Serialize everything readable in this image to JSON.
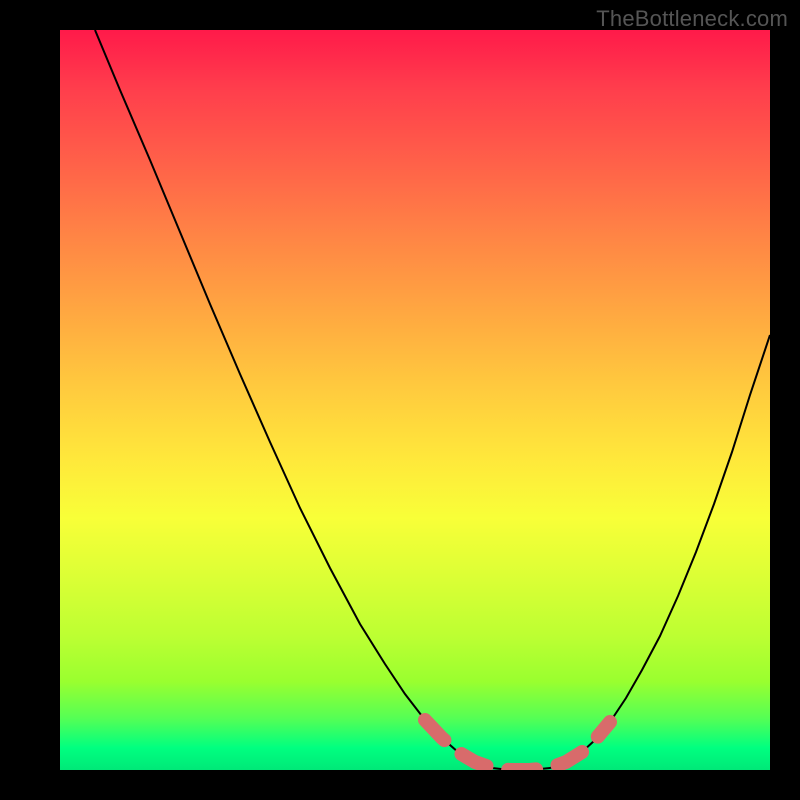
{
  "watermark": "TheBottleneck.com",
  "chart_data": {
    "type": "line",
    "title": "",
    "xlabel": "",
    "ylabel": "",
    "xlim": [
      60,
      770
    ],
    "ylim": [
      30,
      770
    ],
    "series": [
      {
        "name": "black-curve",
        "color": "#000000",
        "stroke_width": 2,
        "type": "line",
        "points": [
          {
            "x": 95,
            "y": 30
          },
          {
            "x": 120,
            "y": 90
          },
          {
            "x": 150,
            "y": 160
          },
          {
            "x": 180,
            "y": 232
          },
          {
            "x": 210,
            "y": 304
          },
          {
            "x": 240,
            "y": 374
          },
          {
            "x": 270,
            "y": 442
          },
          {
            "x": 300,
            "y": 508
          },
          {
            "x": 330,
            "y": 568
          },
          {
            "x": 360,
            "y": 624
          },
          {
            "x": 385,
            "y": 664
          },
          {
            "x": 405,
            "y": 694
          },
          {
            "x": 425,
            "y": 720
          },
          {
            "x": 442,
            "y": 738
          },
          {
            "x": 458,
            "y": 752
          },
          {
            "x": 475,
            "y": 762
          },
          {
            "x": 492,
            "y": 768
          },
          {
            "x": 510,
            "y": 770
          },
          {
            "x": 530,
            "y": 770
          },
          {
            "x": 550,
            "y": 768
          },
          {
            "x": 566,
            "y": 762
          },
          {
            "x": 582,
            "y": 752
          },
          {
            "x": 595,
            "y": 740
          },
          {
            "x": 610,
            "y": 722
          },
          {
            "x": 626,
            "y": 698
          },
          {
            "x": 642,
            "y": 670
          },
          {
            "x": 660,
            "y": 636
          },
          {
            "x": 678,
            "y": 596
          },
          {
            "x": 696,
            "y": 552
          },
          {
            "x": 714,
            "y": 504
          },
          {
            "x": 732,
            "y": 452
          },
          {
            "x": 750,
            "y": 395
          },
          {
            "x": 770,
            "y": 335
          }
        ]
      },
      {
        "name": "red-dash",
        "color": "#d86b6b",
        "stroke_width": 14,
        "type": "dashed-line",
        "dash": "28 22",
        "linecap": "round",
        "points": [
          {
            "x": 425,
            "y": 720
          },
          {
            "x": 442,
            "y": 738
          },
          {
            "x": 458,
            "y": 752
          },
          {
            "x": 475,
            "y": 762
          },
          {
            "x": 492,
            "y": 768
          },
          {
            "x": 510,
            "y": 770
          },
          {
            "x": 530,
            "y": 770
          },
          {
            "x": 550,
            "y": 768
          },
          {
            "x": 566,
            "y": 762
          },
          {
            "x": 582,
            "y": 752
          },
          {
            "x": 595,
            "y": 740
          },
          {
            "x": 610,
            "y": 722
          }
        ]
      }
    ],
    "background_gradient": {
      "direction": "top-to-bottom",
      "stops": [
        {
          "pos": 0.0,
          "color": "#ff1a4a"
        },
        {
          "pos": 0.5,
          "color": "#ffd93c"
        },
        {
          "pos": 1.0,
          "color": "#00e878"
        }
      ]
    }
  }
}
